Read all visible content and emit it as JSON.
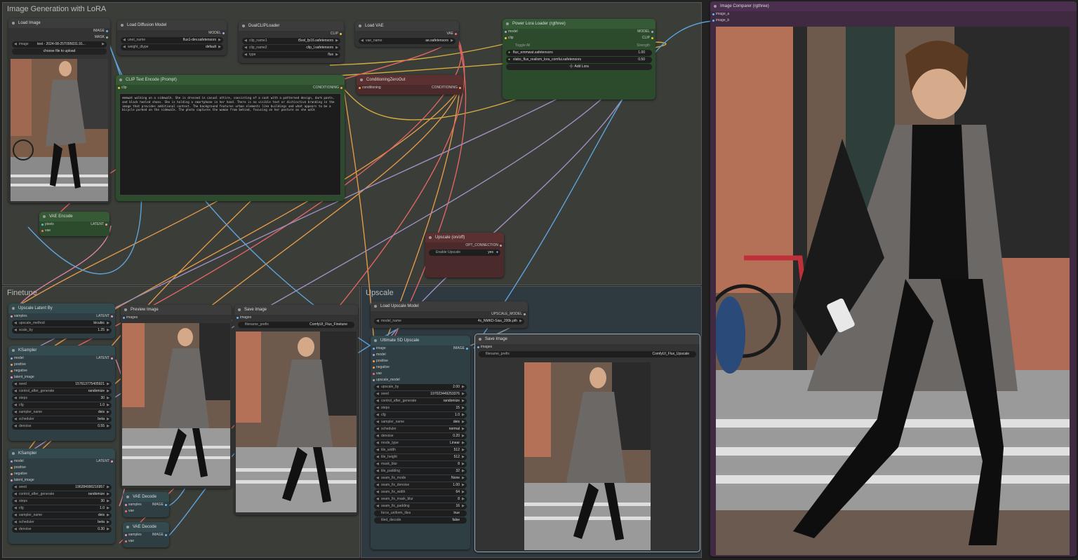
{
  "groups": {
    "main": "Image Generation with LoRA",
    "finetune": "Finetune",
    "upscale": "Upscale"
  },
  "load_image": {
    "title": "Load Image",
    "out1": "IMAGE",
    "out2": "MASK",
    "image_key": "image",
    "image_val": "test - 2024-08-25T095031.91...",
    "upload_btn": "choose file to upload"
  },
  "load_diffusion": {
    "title": "Load Diffusion Model",
    "out": "MODEL",
    "unet_key": "unet_name",
    "unet_val": "flux1-dev.safetensors",
    "dtype_key": "weight_dtype",
    "dtype_val": "default"
  },
  "dual_clip": {
    "title": "DualCLIPLoader",
    "out": "CLIP",
    "c1_key": "clip_name1",
    "c1_val": "t5xxl_fp16.safetensors",
    "c2_key": "clip_name2",
    "c2_val": "clip_l.safetensors",
    "type_key": "type",
    "type_val": "flux"
  },
  "load_vae": {
    "title": "Load VAE",
    "out": "VAE",
    "key": "vae_name",
    "val": "ae.safetensors"
  },
  "lora": {
    "title": "Power Lora Loader (rgthree)",
    "in1": "model",
    "in2": "clip",
    "out1": "MODEL",
    "out2": "CLIP",
    "toggle": "Toggle All",
    "strength": "Strength",
    "l1_name": "flux_emmwat.safetensors",
    "l1_val": "1.00",
    "l2_name": "xlabs_flux_realism_lora_comfui.safetensors",
    "l2_val": "0.50",
    "add": "➕ Add Lora"
  },
  "clip_encode": {
    "title": "CLIP Text Encode (Prompt)",
    "in": "clip",
    "out": "CONDITIONING",
    "text": "emmwat walking on a sidewalk. She is dressed in casual attire, consisting of a coat with a patterned design, dark pants, and black heeled shoes. She is holding a smartphone in her hand. There is no visible text or distinctive branding in the image that provides additional context. The background features urban elements like buildings and what appears to be a bicycle parked on the sidewalk. The photo captures the woman from behind, focusing on her posture as she walk"
  },
  "cond_zero": {
    "title": "ConditioningZeroOut",
    "in": "conditioning",
    "out": "CONDITIONING"
  },
  "vae_encode": {
    "title": "VAE Encode",
    "in1": "pixels",
    "in2": "vae",
    "out": "LATENT"
  },
  "upscale_switch": {
    "title": "Upscale (on/off)",
    "out": "OPT_CONNECTION",
    "key": "Enable Upscale",
    "val": "yes"
  },
  "image_comparer": {
    "title": "Image Comparer (rgthree)",
    "in1": "image_a",
    "in2": "image_b"
  },
  "upscale_latent": {
    "title": "Upscale Latent By",
    "in": "samples",
    "out": "LATENT",
    "m_key": "upscale_method",
    "m_val": "bicubic",
    "s_key": "scale_by",
    "s_val": "1.25"
  },
  "ksampler1": {
    "title": "KSampler",
    "ins": [
      "model",
      "positive",
      "negative",
      "latent_image"
    ],
    "out": "LATENT",
    "widgets": [
      {
        "k": "seed",
        "v": "157613775405921"
      },
      {
        "k": "control_after_generate",
        "v": "randomize"
      },
      {
        "k": "steps",
        "v": "30"
      },
      {
        "k": "cfg",
        "v": "1.0"
      },
      {
        "k": "sampler_name",
        "v": "deis"
      },
      {
        "k": "scheduler",
        "v": "beta"
      },
      {
        "k": "denoise",
        "v": "0.55"
      }
    ]
  },
  "ksampler2": {
    "title": "KSampler",
    "ins": [
      "model",
      "positive",
      "negative",
      "latent_image"
    ],
    "out": "LATENT",
    "widgets": [
      {
        "k": "seed",
        "v": "196284990216957"
      },
      {
        "k": "control_after_generate",
        "v": "randomize"
      },
      {
        "k": "steps",
        "v": "30"
      },
      {
        "k": "cfg",
        "v": "1.0"
      },
      {
        "k": "sampler_name",
        "v": "deis"
      },
      {
        "k": "scheduler",
        "v": "beta"
      },
      {
        "k": "denoise",
        "v": "0.30"
      }
    ]
  },
  "preview": {
    "title": "Preview Image",
    "in": "images"
  },
  "save1": {
    "title": "Save Image",
    "in": "images",
    "key": "filename_prefix",
    "val": "ComfyUI_Flux_Finetune"
  },
  "vae_decode1": {
    "title": "VAE Decode",
    "in1": "samples",
    "in2": "vae",
    "out": "IMAGE"
  },
  "vae_decode2": {
    "title": "VAE Decode",
    "in1": "samples",
    "in2": "vae",
    "out": "IMAGE"
  },
  "load_upscale": {
    "title": "Load Upscale Model",
    "out": "UPSCALE_MODEL",
    "key": "model_name",
    "val": "4x_NMKD-Siax_200k.pth"
  },
  "usd": {
    "title": "Ultimate SD Upscale",
    "ins": [
      "image",
      "model",
      "positive",
      "negative",
      "vae",
      "upscale_model"
    ],
    "out": "IMAGE",
    "widgets": [
      {
        "k": "upscale_by",
        "v": "2.00"
      },
      {
        "k": "seed",
        "v": "197023449253376"
      },
      {
        "k": "control_after_generate",
        "v": "randomize"
      },
      {
        "k": "steps",
        "v": "15"
      },
      {
        "k": "cfg",
        "v": "1.0"
      },
      {
        "k": "sampler_name",
        "v": "deis"
      },
      {
        "k": "scheduler",
        "v": "normal"
      },
      {
        "k": "denoise",
        "v": "0.20"
      },
      {
        "k": "mode_type",
        "v": "Linear"
      },
      {
        "k": "tile_width",
        "v": "512"
      },
      {
        "k": "tile_height",
        "v": "512"
      },
      {
        "k": "mask_blur",
        "v": "8"
      },
      {
        "k": "tile_padding",
        "v": "32"
      },
      {
        "k": "seam_fix_mode",
        "v": "None"
      },
      {
        "k": "seam_fix_denoise",
        "v": "1.00"
      },
      {
        "k": "seam_fix_width",
        "v": "64"
      },
      {
        "k": "seam_fix_mask_blur",
        "v": "8"
      },
      {
        "k": "seam_fix_padding",
        "v": "16"
      }
    ],
    "toggles": [
      {
        "k": "force_uniform_tiles",
        "v": "true"
      },
      {
        "k": "tiled_decode",
        "v": "false"
      }
    ]
  },
  "save2": {
    "title": "Save Image",
    "in": "images",
    "key": "filename_prefix",
    "val": "ComfyUI_Flux_Upscale"
  },
  "colors": {
    "model": "#b39ddb",
    "clip": "#f0c040",
    "vae": "#ff6b6b",
    "conditioning": "#ffa94d",
    "latent": "#f48fb1",
    "image": "#64b5f6"
  }
}
